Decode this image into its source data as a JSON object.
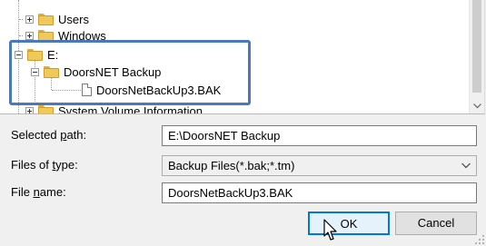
{
  "tree": {
    "nodes": [
      {
        "label": "Users"
      },
      {
        "label": "Windows"
      },
      {
        "label": "E:"
      },
      {
        "label": "DoorsNET Backup"
      },
      {
        "label": "DoorsNetBackUp3.BAK"
      },
      {
        "label": "System Volume Information"
      }
    ]
  },
  "form": {
    "selected_path": {
      "label_pre": "Selected ",
      "label_key": "p",
      "label_post": "ath:",
      "value": "E:\\DoorsNET Backup"
    },
    "files_of_type": {
      "label_pre": "Files of ",
      "label_key": "t",
      "label_post": "ype:",
      "value": "Backup Files(*.bak;*.tm)"
    },
    "file_name": {
      "label_pre": "File ",
      "label_key": "n",
      "label_post": "ame:",
      "value": "DoorsNetBackUp3.BAK"
    }
  },
  "buttons": {
    "ok": "OK",
    "cancel": "Cancel"
  },
  "icons": {
    "folder": "folder-icon",
    "file": "file-icon",
    "expand": "expand-plus-icon",
    "collapse": "collapse-minus-icon",
    "scroll_down": "chevron-down-icon",
    "combo": "chevron-down-icon",
    "cursor": "mouse-pointer-icon"
  },
  "colors": {
    "highlight": "#4a78bd",
    "ok_border": "#0078d7",
    "folder": "#f1c95a"
  }
}
